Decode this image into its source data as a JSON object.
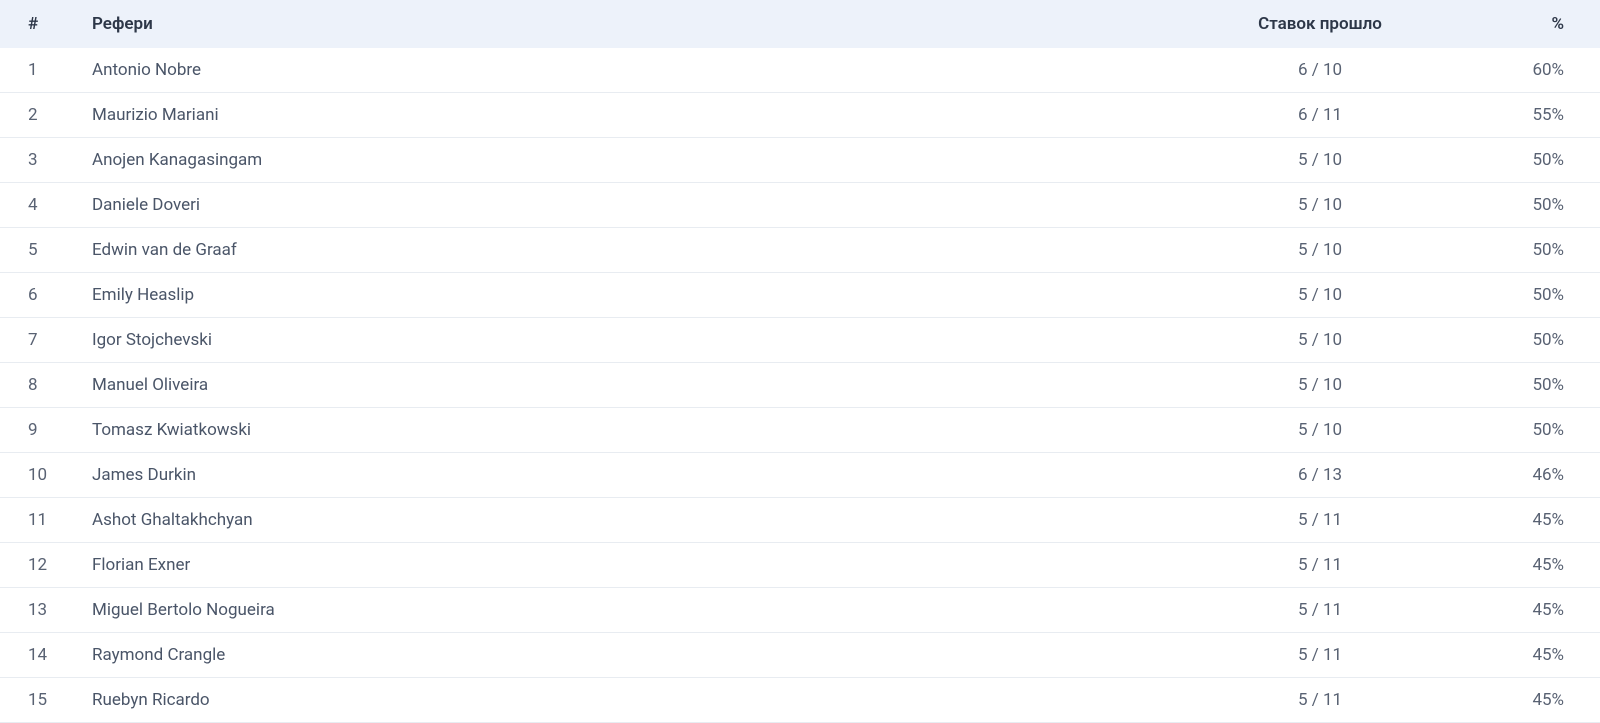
{
  "table": {
    "headers": {
      "rank": "#",
      "name": "Рефери",
      "bets": "Ставок прошло",
      "percent": "%"
    },
    "rows": [
      {
        "rank": "1",
        "name": "Antonio Nobre",
        "bets": "6 / 10",
        "percent": "60%"
      },
      {
        "rank": "2",
        "name": "Maurizio Mariani",
        "bets": "6 / 11",
        "percent": "55%"
      },
      {
        "rank": "3",
        "name": "Anojen Kanagasingam",
        "bets": "5 / 10",
        "percent": "50%"
      },
      {
        "rank": "4",
        "name": "Daniele Doveri",
        "bets": "5 / 10",
        "percent": "50%"
      },
      {
        "rank": "5",
        "name": "Edwin van de Graaf",
        "bets": "5 / 10",
        "percent": "50%"
      },
      {
        "rank": "6",
        "name": "Emily Heaslip",
        "bets": "5 / 10",
        "percent": "50%"
      },
      {
        "rank": "7",
        "name": "Igor Stojchevski",
        "bets": "5 / 10",
        "percent": "50%"
      },
      {
        "rank": "8",
        "name": "Manuel Oliveira",
        "bets": "5 / 10",
        "percent": "50%"
      },
      {
        "rank": "9",
        "name": "Tomasz Kwiatkowski",
        "bets": "5 / 10",
        "percent": "50%"
      },
      {
        "rank": "10",
        "name": "James Durkin",
        "bets": "6 / 13",
        "percent": "46%"
      },
      {
        "rank": "11",
        "name": "Ashot Ghaltakhchyan",
        "bets": "5 / 11",
        "percent": "45%"
      },
      {
        "rank": "12",
        "name": "Florian Exner",
        "bets": "5 / 11",
        "percent": "45%"
      },
      {
        "rank": "13",
        "name": "Miguel Bertolo Nogueira",
        "bets": "5 / 11",
        "percent": "45%"
      },
      {
        "rank": "14",
        "name": "Raymond Crangle",
        "bets": "5 / 11",
        "percent": "45%"
      },
      {
        "rank": "15",
        "name": "Ruebyn Ricardo",
        "bets": "5 / 11",
        "percent": "45%"
      }
    ]
  }
}
